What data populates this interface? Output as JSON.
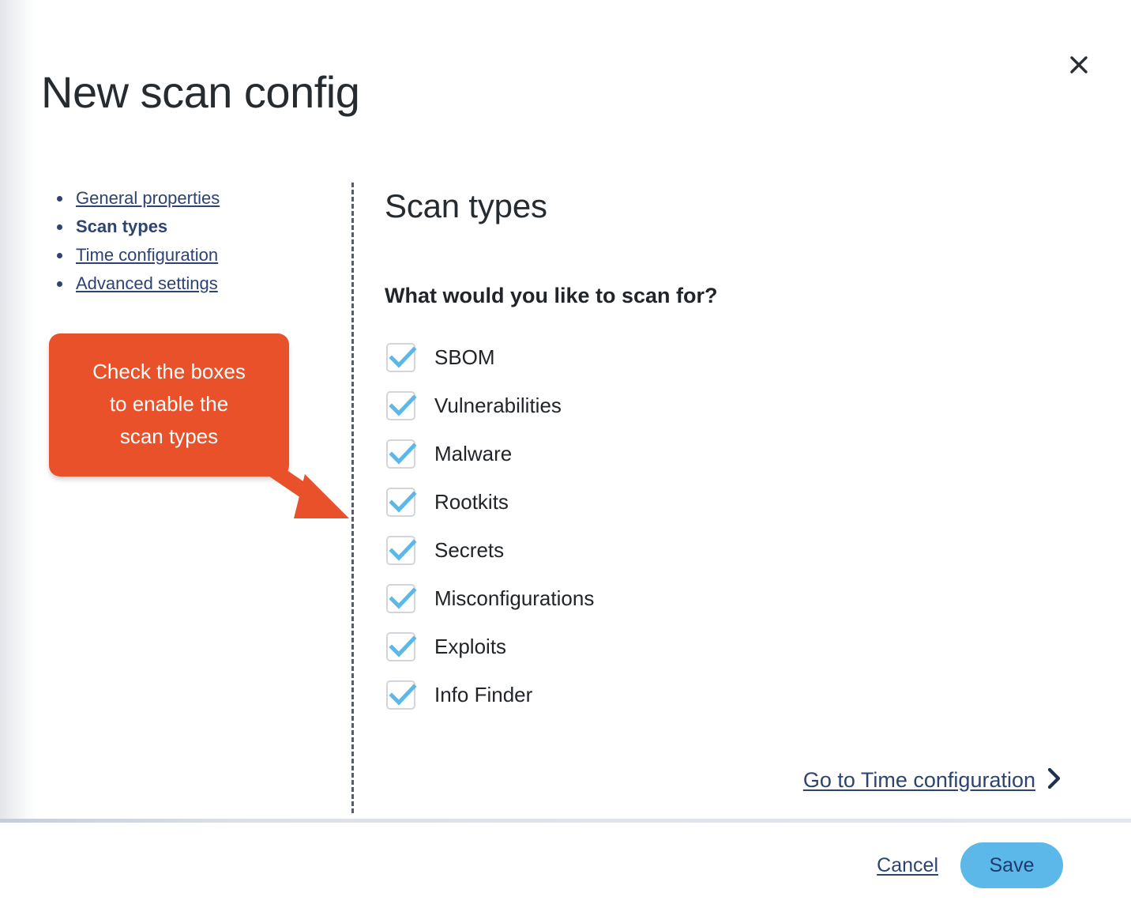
{
  "dialog": {
    "title": "New scan config",
    "close_icon": "close-x-icon"
  },
  "sidebar": {
    "items": [
      {
        "label": "General properties",
        "active": false
      },
      {
        "label": "Scan types",
        "active": true
      },
      {
        "label": "Time configuration",
        "active": false
      },
      {
        "label": "Advanced settings",
        "active": false
      }
    ]
  },
  "callout": {
    "lines": [
      "Check the boxes",
      "to enable the",
      "scan types"
    ],
    "text": "Check the boxes to enable the scan types",
    "background_color": "#e8512a",
    "text_color": "#ffffff",
    "arrow_icon": "arrow-down-right-icon"
  },
  "main": {
    "section_title": "Scan types",
    "question": "What would you like to scan for?",
    "scan_types": [
      {
        "label": "SBOM",
        "checked": true
      },
      {
        "label": "Vulnerabilities",
        "checked": true
      },
      {
        "label": "Malware",
        "checked": true
      },
      {
        "label": "Rootkits",
        "checked": true
      },
      {
        "label": "Secrets",
        "checked": true
      },
      {
        "label": "Misconfigurations",
        "checked": true
      },
      {
        "label": "Exploits",
        "checked": true
      },
      {
        "label": "Info Finder",
        "checked": true
      }
    ],
    "next_step_label": "Go to Time configuration",
    "next_step_icon": "chevron-right-icon"
  },
  "footer": {
    "cancel_label": "Cancel",
    "save_label": "Save"
  },
  "colors": {
    "accent_blue": "#5bb8e8",
    "navy_link": "#2d4372",
    "callout_orange": "#e8512a",
    "checkbox_border": "#d2d6da",
    "text_dark": "#212529"
  }
}
